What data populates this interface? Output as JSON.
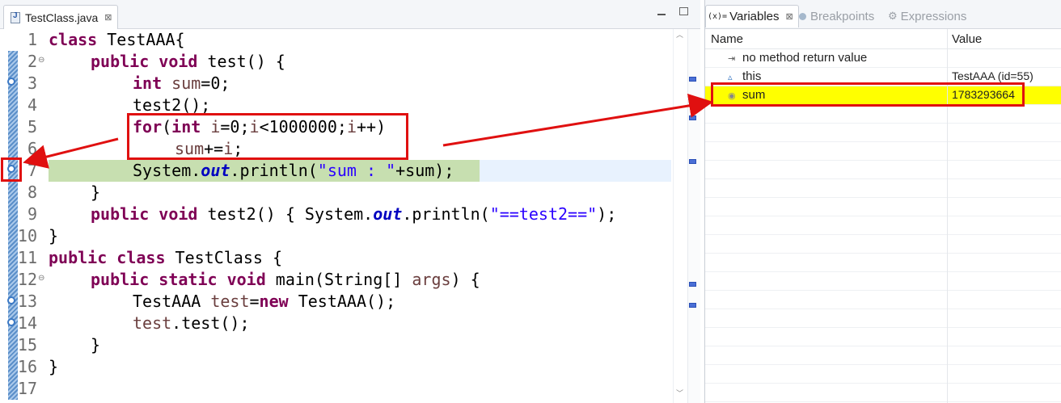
{
  "editor": {
    "tab_label": "TestClass.java",
    "close_glyph": "⊠",
    "line_numbers": [
      "1",
      "2",
      "3",
      "4",
      "5",
      "6",
      "7",
      "8",
      "9",
      "10",
      "11",
      "12",
      "13",
      "14",
      "15",
      "16",
      "17"
    ]
  },
  "code": {
    "l1_kw": "class",
    "l1_rest": " TestAAA{",
    "l2_kw1": "public",
    "l2_kw2": "void",
    "l2_rest": " test() {",
    "l3_kw": "int",
    "l3_var": "sum",
    "l3_rest": "=0;",
    "l4": "test2();",
    "l5_kw1": "for",
    "l5_mid1": "(",
    "l5_kw2": "int",
    "l5_var1": " i",
    "l5_mid2": "=0;",
    "l5_var2": "i",
    "l5_mid3": "<1000000;",
    "l5_var3": "i",
    "l5_mid4": "++)",
    "l6_a": "sum",
    "l6_b": "+=",
    "l6_c": "i",
    "l6_d": ";",
    "l7_a": "System.",
    "l7_fld": "out",
    "l7_b": ".println(",
    "l7_str": "\"sum : \"",
    "l7_c": "+sum);",
    "l8": "}",
    "l9_kw1": "public",
    "l9_kw2": "void",
    "l9_a": " test2() { System.",
    "l9_fld": "out",
    "l9_b": ".println(",
    "l9_str": "\"==test2==\"",
    "l9_c": ");",
    "l10": "}",
    "l11_kw1": "public",
    "l11_kw2": "class",
    "l11_rest": " TestClass {",
    "l12_kw1": "public",
    "l12_kw2": "static",
    "l12_kw3": "void",
    "l12_a": " main(String[] ",
    "l12_var": "args",
    "l12_b": ") {",
    "l13_a": "TestAAA ",
    "l13_var": "test",
    "l13_b": "=",
    "l13_kw": "new",
    "l13_c": " TestAAA();",
    "l14_var": "test",
    "l14_rest": ".test();",
    "l15": "}",
    "l16": "}"
  },
  "variables_view": {
    "tabs": [
      {
        "icon": "(x)=",
        "label": "Variables",
        "close": "⊠"
      },
      {
        "icon": "breakpoints-icon",
        "label": "Breakpoints"
      },
      {
        "icon": "expressions-icon",
        "label": "Expressions"
      }
    ],
    "columns": [
      "Name",
      "Value"
    ],
    "rows": [
      {
        "name": "no method return value",
        "value": ""
      },
      {
        "name": "this",
        "value": "TestAAA  (id=55)"
      },
      {
        "name": "sum",
        "value": "1783293664",
        "highlight": "#ffff00"
      }
    ]
  },
  "colors": {
    "keyword": "#7f0055",
    "string": "#2a00ff",
    "field": "#0000c0",
    "annotation_red": "#e01010",
    "current_line": "#c7dfb0"
  }
}
